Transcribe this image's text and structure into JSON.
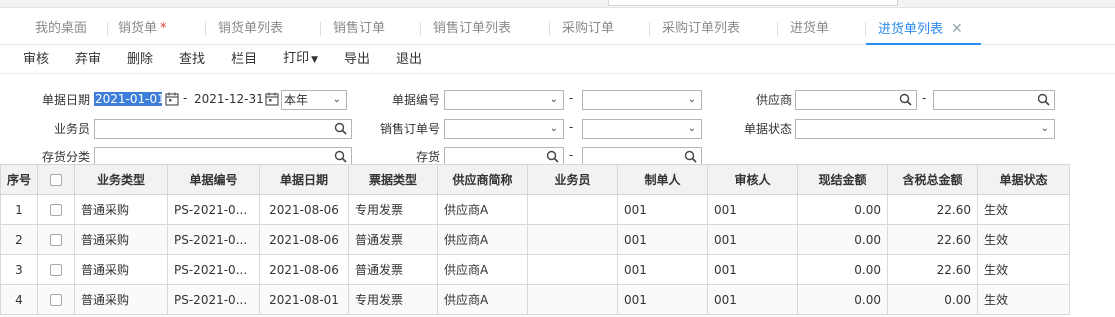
{
  "tabs": [
    {
      "label": "我的桌面",
      "active": false,
      "starred": false
    },
    {
      "label": "销货单",
      "active": false,
      "starred": true
    },
    {
      "label": "销货单列表",
      "active": false,
      "starred": false
    },
    {
      "label": "销售订单",
      "active": false,
      "starred": false
    },
    {
      "label": "销售订单列表",
      "active": false,
      "starred": false
    },
    {
      "label": "采购订单",
      "active": false,
      "starred": false
    },
    {
      "label": "采购订单列表",
      "active": false,
      "starred": false
    },
    {
      "label": "进货单",
      "active": false,
      "starred": false
    },
    {
      "label": "进货单列表",
      "active": true,
      "starred": false
    }
  ],
  "tab_close_glyph": "✕",
  "tab_star_glyph": "*",
  "toolbar": {
    "audit": "审核",
    "unaudit": "弃审",
    "delete": "删除",
    "find": "查找",
    "columns": "栏目",
    "print": "打印",
    "export": "导出",
    "exit": "退出"
  },
  "filters": {
    "date_label": "单据日期",
    "date_from": "2021-01-01",
    "date_to": "2021-12-31",
    "date_range": "本年",
    "bill_no_label": "单据编号",
    "bill_no_from": "",
    "bill_no_to": "",
    "supplier_label": "供应商",
    "supplier_from": "",
    "supplier_to": "",
    "salesman_label": "业务员",
    "salesman": "",
    "sales_order_label": "销售订单号",
    "sales_order_from": "",
    "sales_order_to": "",
    "status_label": "单据状态",
    "status": "",
    "stock_class_label": "存货分类",
    "stock_class": "",
    "stock_label": "存货",
    "stock_from": "",
    "stock_to": "",
    "dash": "-"
  },
  "table": {
    "columns": [
      "序号",
      "",
      "业务类型",
      "单据编号",
      "单据日期",
      "票据类型",
      "供应商简称",
      "业务员",
      "制单人",
      "审核人",
      "现结金额",
      "含税总金额",
      "单据状态"
    ],
    "rows": [
      {
        "idx": "1",
        "biz_type": "普通采购",
        "bill_no": "PS-2021-0...",
        "date": "2021-08-06",
        "invoice_type": "专用发票",
        "supplier": "供应商A",
        "salesman": "",
        "creator": "001",
        "auditor": "001",
        "cash_amount": "0.00",
        "total_amount": "22.60",
        "status": "生效"
      },
      {
        "idx": "2",
        "biz_type": "普通采购",
        "bill_no": "PS-2021-0...",
        "date": "2021-08-06",
        "invoice_type": "普通发票",
        "supplier": "供应商A",
        "salesman": "",
        "creator": "001",
        "auditor": "001",
        "cash_amount": "0.00",
        "total_amount": "22.60",
        "status": "生效"
      },
      {
        "idx": "3",
        "biz_type": "普通采购",
        "bill_no": "PS-2021-0...",
        "date": "2021-08-06",
        "invoice_type": "普通发票",
        "supplier": "供应商A",
        "salesman": "",
        "creator": "001",
        "auditor": "001",
        "cash_amount": "0.00",
        "total_amount": "22.60",
        "status": "生效"
      },
      {
        "idx": "4",
        "biz_type": "普通采购",
        "bill_no": "PS-2021-0...",
        "date": "2021-08-01",
        "invoice_type": "专用发票",
        "supplier": "供应商A",
        "salesman": "",
        "creator": "001",
        "auditor": "001",
        "cash_amount": "0.00",
        "total_amount": "0.00",
        "status": "生效"
      }
    ]
  },
  "colors": {
    "accent": "#2d8cf0",
    "selection": "#3d7fd8",
    "star": "#e23c3c"
  }
}
